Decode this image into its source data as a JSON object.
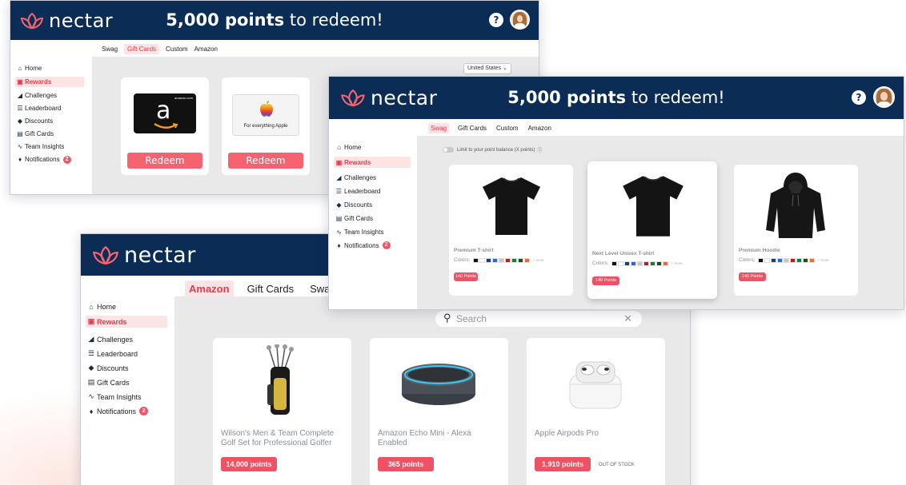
{
  "brand": {
    "name": "nectar",
    "primary": "#0b2d55",
    "accent": "#f05265",
    "logo_icon": "lotus-icon"
  },
  "header": {
    "points_bold": "5,000 points",
    "points_rest": " to redeem!",
    "help_label": "?"
  },
  "sidebar": {
    "items": [
      {
        "label": "Home",
        "icon": "home-icon"
      },
      {
        "label": "Rewards",
        "icon": "gift-icon"
      },
      {
        "label": "Challenges",
        "icon": "challenges-icon"
      },
      {
        "label": "Leaderboard",
        "icon": "leaderboard-icon"
      },
      {
        "label": "Discounts",
        "icon": "tag-icon"
      },
      {
        "label": "Gift Cards",
        "icon": "gift-card-icon"
      },
      {
        "label": "Team Insights",
        "icon": "trend-icon"
      },
      {
        "label": "Notifications",
        "icon": "bell-icon",
        "badge": "2"
      }
    ]
  },
  "window_giftcards": {
    "tabs": [
      "Swag",
      "Gift Cards",
      "Custom",
      "Amazon"
    ],
    "country_select": "United States",
    "cards": [
      {
        "brand": "amazon",
        "brand_logo_text": "a",
        "corner_text": "amazon.com",
        "button": "Redeem"
      },
      {
        "brand": "apple",
        "caption": "For everything Apple",
        "button": "Redeem"
      }
    ]
  },
  "window_swag": {
    "tabs": [
      "Swag",
      "Gift Cards",
      "Custom",
      "Amazon"
    ],
    "limit_toggle_label": "Limit to your point balance (X points)",
    "colors_label": "Colors:",
    "more_label": "+ more",
    "products": [
      {
        "name": "Premium T-shirt",
        "points": "140 Points",
        "image": "tshirt",
        "swatches": [
          "#111111",
          "#ffffff",
          "#1f3f7a",
          "#2b6bd1",
          "#c7c7c7",
          "#b3202a",
          "#1b7a3a",
          "#1e4d2b",
          "#f06a2a"
        ]
      },
      {
        "name": "Next Level Unisex T-shirt",
        "points": "140 Points",
        "image": "tshirt",
        "swatches": [
          "#111111",
          "#ffffff",
          "#1f3f7a",
          "#2b6bd1",
          "#c7c7c7",
          "#b3202a",
          "#1b7a3a",
          "#1e4d2b",
          "#f06a2a"
        ]
      },
      {
        "name": "Premium Hoodie",
        "points": "140 Points",
        "image": "hoodie",
        "swatches": [
          "#111111",
          "#ffffff",
          "#1f3f7a",
          "#2b6bd1",
          "#c7c7c7",
          "#b3202a",
          "#1b7a3a",
          "#1e4d2b",
          "#f06a2a"
        ]
      }
    ]
  },
  "window_amazon": {
    "tabs": [
      "Amazon",
      "Gift Cards",
      "Swag"
    ],
    "search_placeholder": "Search",
    "products": [
      {
        "name": "Wilson's Men & Team Complete Golf Set for Professional Golfer",
        "points": "14,000 points",
        "image": "golf-bag"
      },
      {
        "name": "Amazon Echo Mini - Alexa Enabled",
        "points": "365 points",
        "image": "echo-dot"
      },
      {
        "name": "Apple Airpods Pro",
        "points": "1,910 points",
        "image": "airpods",
        "status": "OUT OF STOCK"
      }
    ]
  }
}
